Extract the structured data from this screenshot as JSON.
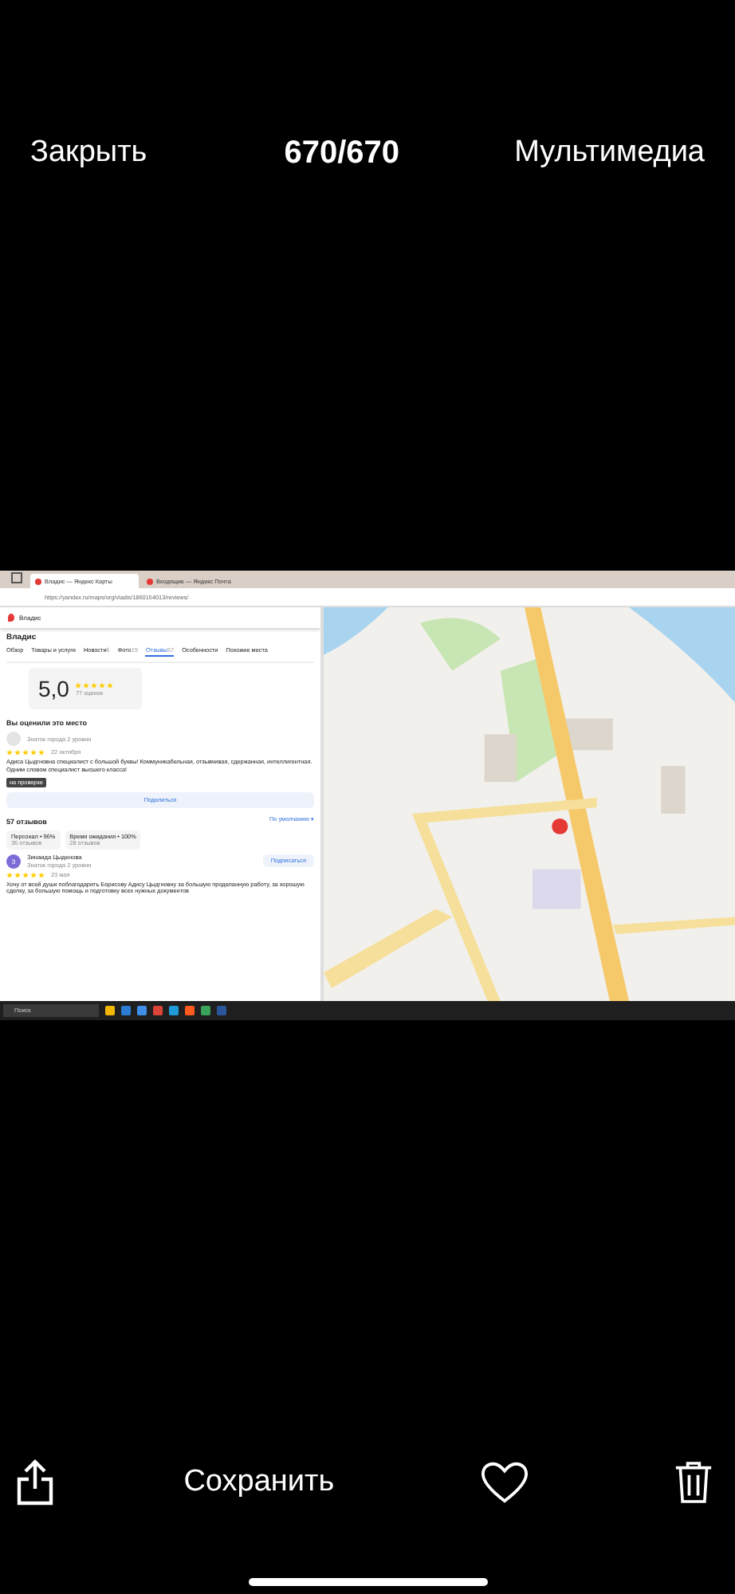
{
  "header": {
    "close_label": "Закрыть",
    "counter": "670/670",
    "media_label": "Мультимедиа"
  },
  "screenshot": {
    "browser_tabs": [
      {
        "title": "Владис — Яндекс Карты",
        "selected": true
      },
      {
        "title": "Входящие — Яндекс Почта",
        "selected": false
      }
    ],
    "address": "https://yandex.ru/maps/org/vladis/1860154013/reviews/",
    "search_value": "Владис",
    "place_name": "Владис",
    "place_tabs": [
      {
        "label": "Обзор",
        "selected": false
      },
      {
        "label": "Товары и услуги",
        "selected": false
      },
      {
        "label": "Новости",
        "count": "6",
        "selected": false
      },
      {
        "label": "Фото",
        "count": "19",
        "selected": false
      },
      {
        "label": "Отзывы",
        "count": "57",
        "selected": true
      },
      {
        "label": "Особенности",
        "selected": false
      },
      {
        "label": "Похожие места",
        "selected": false
      }
    ],
    "rating": {
      "value": "5,0",
      "stars": 5,
      "count": "77 оценок"
    },
    "my_review_title": "Вы оценили это место",
    "my_review": {
      "level_label": "Знаток города 2 уровня",
      "stars": 5,
      "date": "22 октября",
      "text": "Адиса Цыдгновна специалист с большой буквы! Коммуникабельная, отзывчивая, сдержанная, интеллигентная. Одним словом специалист высшего класса!",
      "badge": "на проверке"
    },
    "share_label": "Поделиться",
    "reviews_title": "57 отзывов",
    "sort_label": "По умолчанию ▾",
    "aspects": [
      {
        "label": "Персонал • 96%",
        "sub": "36 отзывов"
      },
      {
        "label": "Время ожидания • 100%",
        "sub": "28 отзывов"
      }
    ],
    "review": {
      "avatar_letter": "З",
      "author": "Зинаида Цыденова",
      "level_label": "Знаток города 2 уровня",
      "subscribe_label": "Подписаться",
      "stars": 5,
      "date": "23 мая",
      "text": "Хочу от всей души поблагодарить Борисову Адису Цыдгновну за большую проделанную работу, за хорошую сделку, за большую помощь и подготовку всех нужных документов"
    },
    "taskbar_search": "Поиск"
  },
  "toolbar": {
    "save_label": "Сохранить",
    "liked": false
  }
}
